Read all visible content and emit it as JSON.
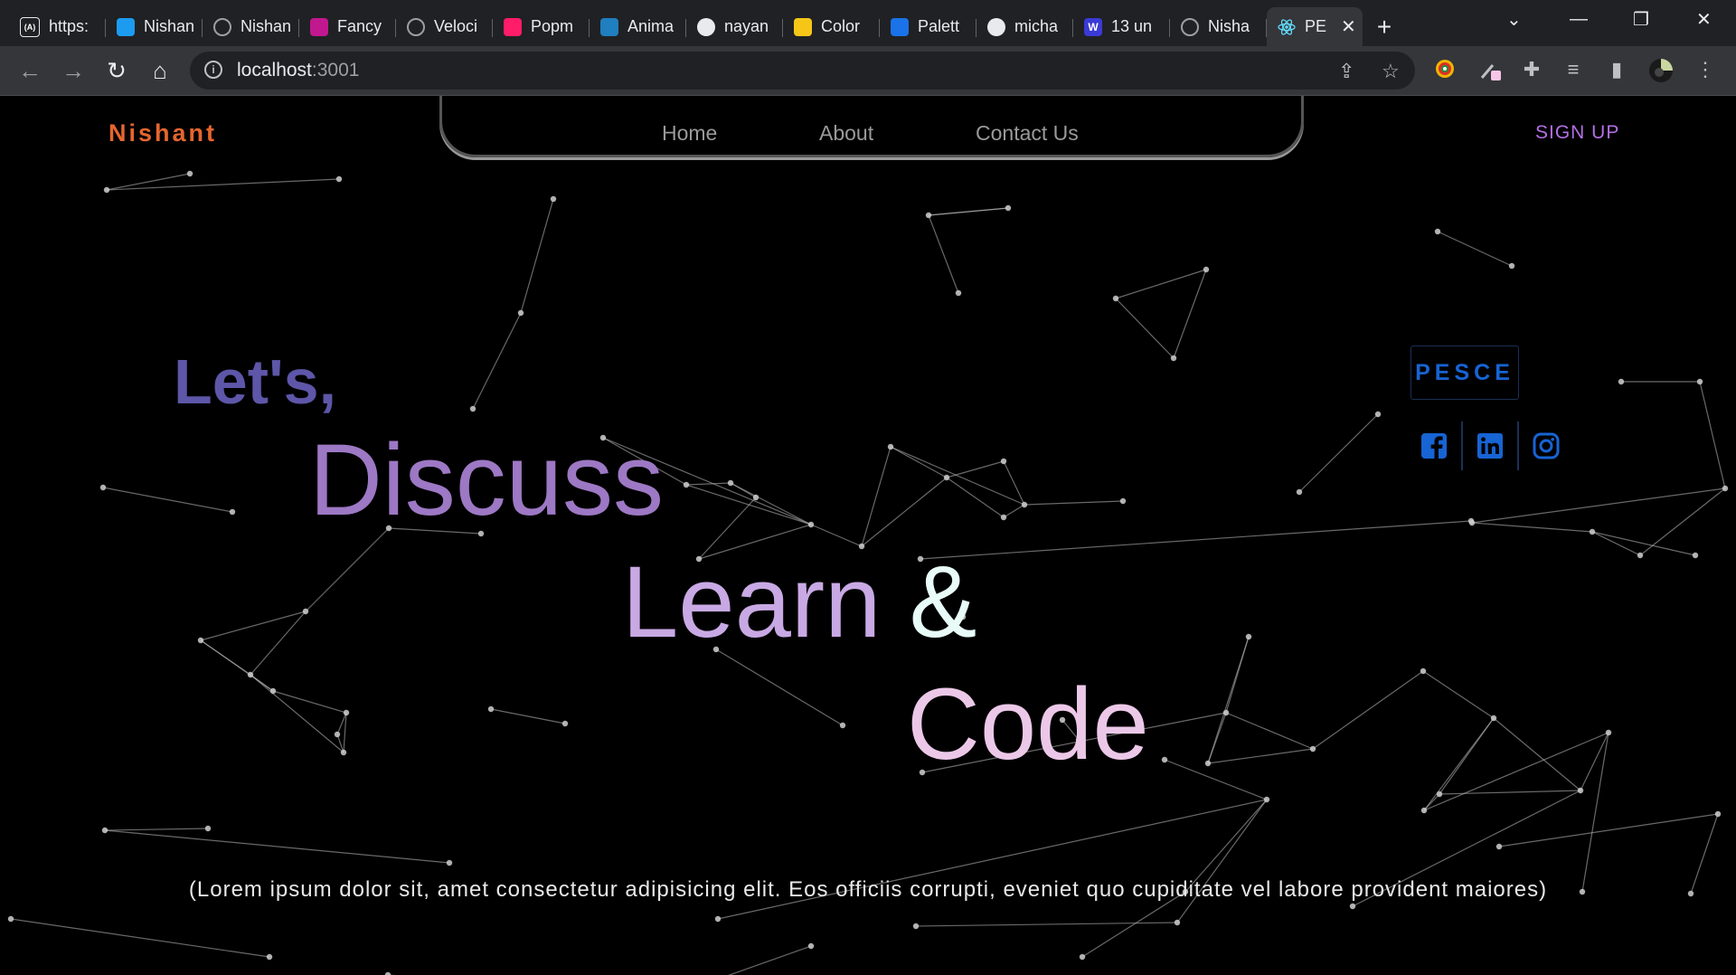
{
  "browser": {
    "tabs": [
      {
        "label": "https:",
        "icon": "api-icon",
        "color": "#202124"
      },
      {
        "label": "Nishan",
        "icon": "twitter-icon",
        "color": "#1d9bf0"
      },
      {
        "label": "Nishan",
        "icon": "globe-icon",
        "color": "#9aa0a6"
      },
      {
        "label": "Fancy",
        "icon": "fancy-icon",
        "color": "#c2188f"
      },
      {
        "label": "Veloci",
        "icon": "globe-icon",
        "color": "#9aa0a6"
      },
      {
        "label": "Popm",
        "icon": "popmotion-icon",
        "color": "#ff1c68"
      },
      {
        "label": "Anima",
        "icon": "code-icon",
        "color": "#1f7fbf"
      },
      {
        "label": "nayan",
        "icon": "github-icon",
        "color": "#e8eaed"
      },
      {
        "label": "Color",
        "icon": "color-icon",
        "color": "#f5c518"
      },
      {
        "label": "Palett",
        "icon": "palette-icon",
        "color": "#1a73e8"
      },
      {
        "label": "micha",
        "icon": "github-icon",
        "color": "#e8eaed"
      },
      {
        "label": "13 un",
        "icon": "w-icon",
        "color": "#3a3ad6"
      },
      {
        "label": "Nisha",
        "icon": "globe-icon",
        "color": "#9aa0a6"
      },
      {
        "label": "PE",
        "icon": "react-icon",
        "color": "#61dafb"
      }
    ],
    "url_host": "localhost",
    "url_port": ":3001"
  },
  "nav": {
    "logo": "Nishant",
    "links": [
      "Home",
      "About",
      "Contact Us"
    ],
    "signup": "SIGN UP"
  },
  "hero": {
    "line1": "Let's,",
    "line2": "Discuss",
    "line3": "Learn",
    "line3_amp": "&",
    "line4": "Code",
    "colors": {
      "line1": "#5e56a8",
      "line2": "#9d78c4",
      "line3": "#c8a9e4",
      "amp": "#e8fbf7",
      "line4": "#ecc8e8"
    }
  },
  "side": {
    "badge": "PESCE",
    "socials": [
      "facebook-icon",
      "linkedin-icon",
      "instagram-icon"
    ],
    "accent": "#1764d4"
  },
  "tagline": "(Lorem ipsum dolor sit, amet consectetur adipisicing elit. Eos officiis corrupti, eveniet quo cupiditate vel labore provident maiores)"
}
